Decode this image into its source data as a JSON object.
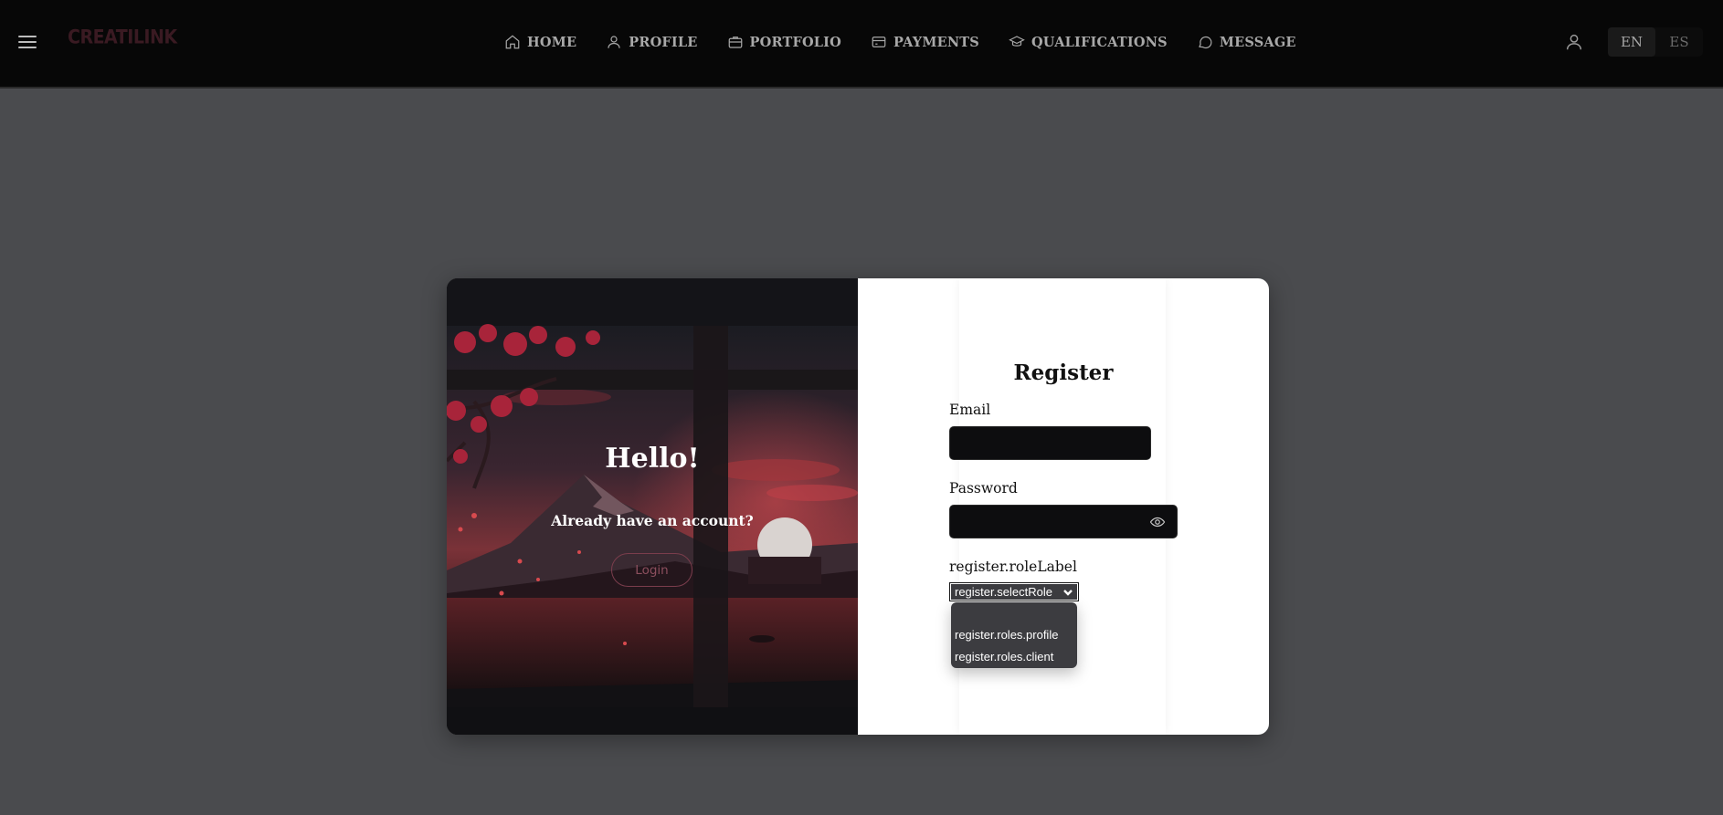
{
  "header": {
    "logo": "CREATILINK",
    "nav": [
      {
        "label": "HOME",
        "icon": "home-icon"
      },
      {
        "label": "PROFILE",
        "icon": "user-icon"
      },
      {
        "label": "PORTFOLIO",
        "icon": "briefcase-icon"
      },
      {
        "label": "PAYMENTS",
        "icon": "credit-card-icon"
      },
      {
        "label": "QUALIFICATIONS",
        "icon": "graduation-cap-icon"
      },
      {
        "label": "MESSAGE",
        "icon": "chat-bubble-icon"
      }
    ],
    "languages": [
      {
        "label": "EN",
        "active": true
      },
      {
        "label": "ES",
        "active": false
      }
    ]
  },
  "left_panel": {
    "heading": "Hello!",
    "subtext": "Already have an account?",
    "login_button": "Login"
  },
  "register": {
    "title": "Register",
    "email_label": "Email",
    "email_value": "",
    "password_label": "Password",
    "password_value": "",
    "role_label": "register.roleLabel",
    "role_selected": "register.selectRole",
    "role_options": [
      "register.roles.profile",
      "register.roles.client"
    ]
  },
  "colors": {
    "topbar_bg": "#070707",
    "page_bg": "#4a4b4e",
    "accent_login": "#8c4f5e",
    "input_bg": "#0d0d0f"
  }
}
